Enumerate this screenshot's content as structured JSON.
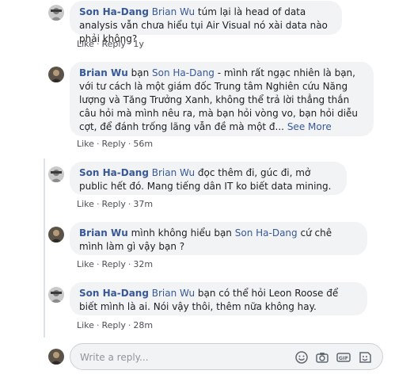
{
  "comments": [
    {
      "author": "Son Ha-Dang",
      "mention": "Brian Wu",
      "text": "túm lại là head of data analysis vẫn chưa hiểu tụi Air Visual nó xài data nào phải không?",
      "like": "Like",
      "reply": "Reply",
      "time": "1y"
    },
    {
      "author": "Brian Wu",
      "text_pre": "bạn",
      "mention": "Son Ha-Dang",
      "text": "- mình rất ngạc nhiên là bạn, với tư cách là một giám đốc Trung tâm Nghiên cứu Năng lượng và Tăng Trưởng Xanh, không thể trả lời thẳng thắn câu hỏi mà mình nêu ra, mà bạn hỏi vòng vo, bạn hỏi diễu cợt, để đánh trống lãng vẫn đề mà một đ...",
      "see_more": "See More",
      "like": "Like",
      "reply": "Reply",
      "time": "56m"
    },
    {
      "author": "Son Ha-Dang",
      "mention": "Brian Wu",
      "text": "đọc thêm đi, gúc đi, mở public hết đó. Mang tiếng dân IT ko biết data mining.",
      "like": "Like",
      "reply": "Reply",
      "time": "37m"
    },
    {
      "author": "Brian Wu",
      "text_pre": "mình không hiểu bạn",
      "mention": "Son Ha-Dang",
      "text": "cứ chê mình làm gì vậy bạn ?",
      "like": "Like",
      "reply": "Reply",
      "time": "32m"
    },
    {
      "author": "Son Ha-Dang",
      "mention": "Brian Wu",
      "text": "bạn có thể hỏi Leon Roose để biết mình là ai. Nói vậy thôi, thêm nữa không hay.",
      "like": "Like",
      "reply": "Reply",
      "time": "28m"
    }
  ],
  "composer": {
    "placeholder": "Write a reply...",
    "icons": [
      "emoji-icon",
      "camera-icon",
      "gif-icon",
      "sticker-icon"
    ]
  },
  "colors": {
    "link": "#385898",
    "bubble": "#f2f3f5",
    "meta": "#606770",
    "thread_line": "#dbe1f0"
  }
}
